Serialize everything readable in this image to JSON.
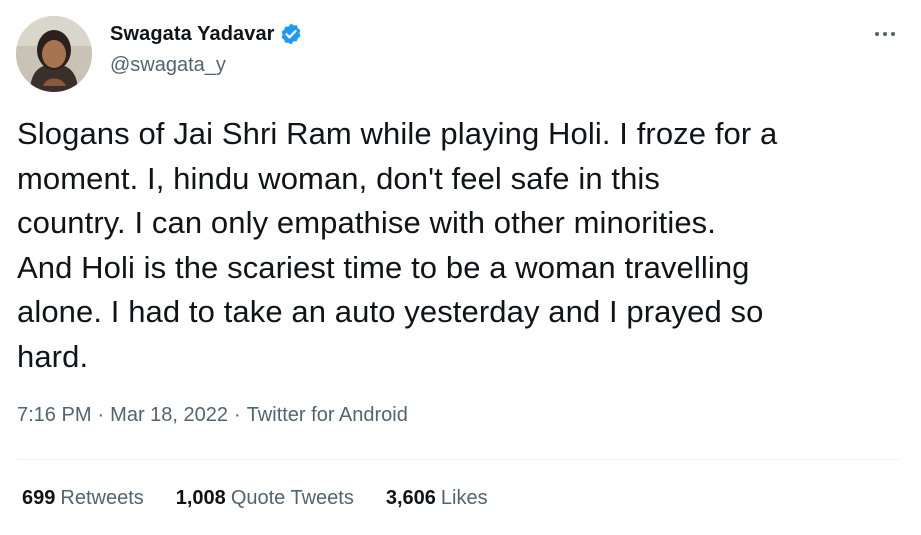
{
  "author": {
    "display_name": "Swagata Yadavar",
    "handle": "@swagata_y",
    "verified": true,
    "verified_color": "#1d9bf0"
  },
  "tweet": {
    "text": "Slogans of Jai Shri Ram while playing Holi. I froze for a\nmoment. I, hindu woman, don't feel safe in this\ncountry. I can only empathise with other minorities.\nAnd Holi is the scariest time to be a woman travelling\nalone. I had to take an auto yesterday and I prayed so\nhard.",
    "time": "7:16 PM",
    "separator": "·",
    "date": "Mar 18, 2022",
    "source": "Twitter for Android"
  },
  "stats": {
    "retweets": {
      "count": "699",
      "label": "Retweets"
    },
    "quote_tweets": {
      "count": "1,008",
      "label": "Quote Tweets"
    },
    "likes": {
      "count": "3,606",
      "label": "Likes"
    }
  },
  "icons": {
    "more": "more-horizontal-icon",
    "verified": "verified-badge-icon"
  }
}
